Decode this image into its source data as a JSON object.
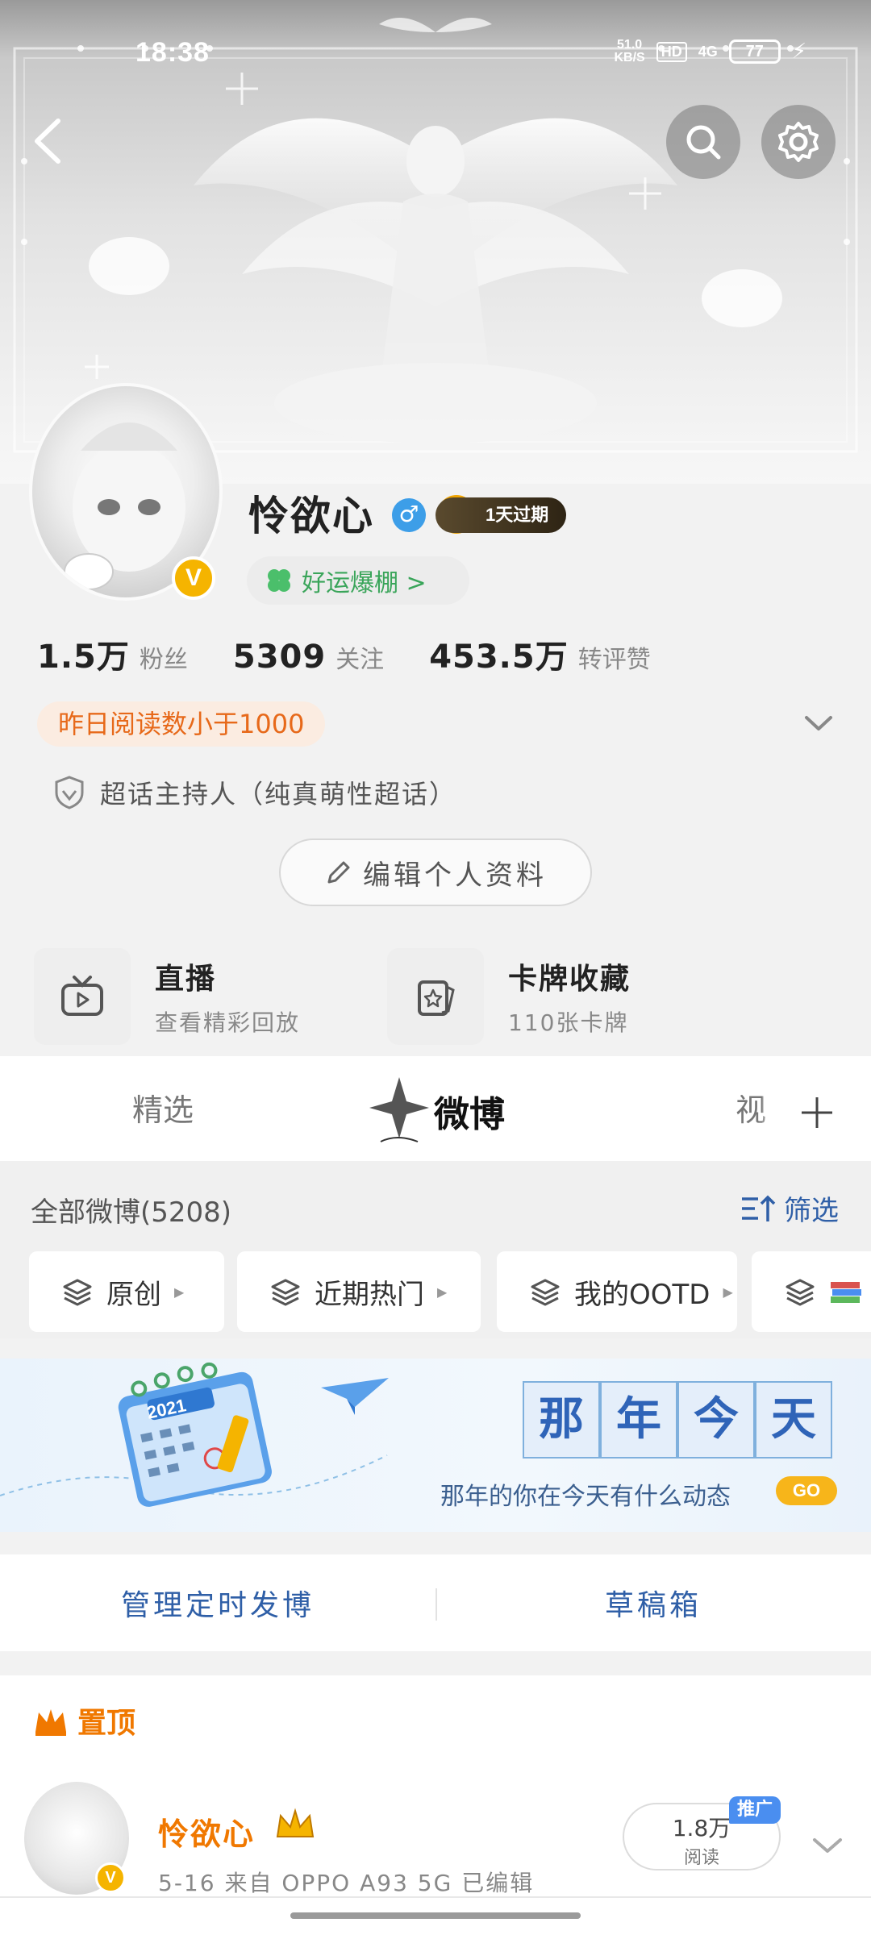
{
  "status_bar": {
    "time": "18:38",
    "net_speed_value": "51.0",
    "net_speed_unit": "KB/S",
    "hd_label": "HD",
    "signal_label": "4G",
    "battery": "77"
  },
  "profile": {
    "username": "怜欲心",
    "gender_symbol": "♂",
    "vip_badge": "1天过期",
    "verified_symbol": "V",
    "luck_label": "好运爆棚 >",
    "stats": [
      {
        "value": "1.5万",
        "label": "粉丝"
      },
      {
        "value": "5309",
        "label": "关注"
      },
      {
        "value": "453.5万",
        "label": "转评赞"
      }
    ],
    "read_notice": "昨日阅读数小于1000",
    "host_text": "超话主持人（纯真萌性超话）",
    "edit_button": "编辑个人资料"
  },
  "features": [
    {
      "title": "直播",
      "subtitle": "查看精彩回放",
      "icon": "tv-icon"
    },
    {
      "title": "卡牌收藏",
      "subtitle": "110张卡牌",
      "icon": "card-star-icon"
    }
  ],
  "tabs": {
    "items": [
      "精选",
      "微博",
      "视"
    ],
    "active": "微博"
  },
  "posts": {
    "all_label": "全部微博(5208)",
    "filter_label": "筛选",
    "chips": [
      "原创",
      "近期热门",
      "我的OOTD"
    ]
  },
  "on_this_day": {
    "chars": [
      "那",
      "年",
      "今",
      "天"
    ],
    "subtitle": "那年的你在今天有什么动态",
    "go_label": "GO",
    "calendar_year": "2021"
  },
  "manage": {
    "scheduled": "管理定时发博",
    "drafts": "草稿箱"
  },
  "pinned": {
    "header": "置顶",
    "author": "怜欲心",
    "meta": "5-16  来自 OPPO A93 5G  已编辑",
    "reads_value": "1.8万",
    "reads_label": "阅读",
    "promo_label": "推广"
  },
  "colors": {
    "accent_orange": "#f07800",
    "link_blue": "#2f5fa7",
    "vip_gold": "#f5b400",
    "luck_green": "#3aa55a"
  }
}
